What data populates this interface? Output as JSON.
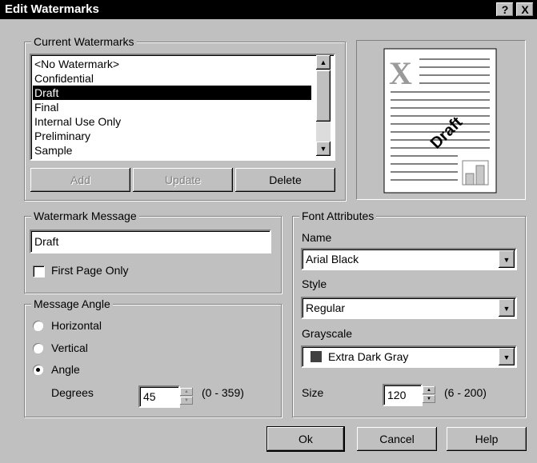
{
  "window": {
    "title": "Edit Watermarks",
    "help_btn": "?",
    "close_btn": "X"
  },
  "current_watermarks": {
    "label": "Current Watermarks",
    "items": [
      "<No Watermark>",
      "Confidential",
      "Draft",
      "Final",
      "Internal Use Only",
      "Preliminary",
      "Sample"
    ],
    "selected_index": 2,
    "add_label": "Add",
    "update_label": "Update",
    "delete_label": "Delete"
  },
  "preview": {
    "watermark_text": "Draft",
    "logo_letter": "X"
  },
  "watermark_message": {
    "label": "Watermark Message",
    "value": "Draft",
    "first_page_only_label": "First Page Only",
    "first_page_only_checked": false
  },
  "message_angle": {
    "label": "Message Angle",
    "horizontal_label": "Horizontal",
    "vertical_label": "Vertical",
    "angle_label": "Angle",
    "selected": "Angle",
    "degrees_label": "Degrees",
    "degrees_value": "45",
    "degrees_range": "(0 - 359)"
  },
  "font_attributes": {
    "label": "Font Attributes",
    "name_label": "Name",
    "name_value": "Arial Black",
    "style_label": "Style",
    "style_value": "Regular",
    "grayscale_label": "Grayscale",
    "grayscale_value": "Extra Dark Gray",
    "grayscale_swatch": "#404040",
    "size_label": "Size",
    "size_value": "120",
    "size_range": "(6 - 200)"
  },
  "buttons": {
    "ok": "Ok",
    "cancel": "Cancel",
    "help": "Help"
  }
}
